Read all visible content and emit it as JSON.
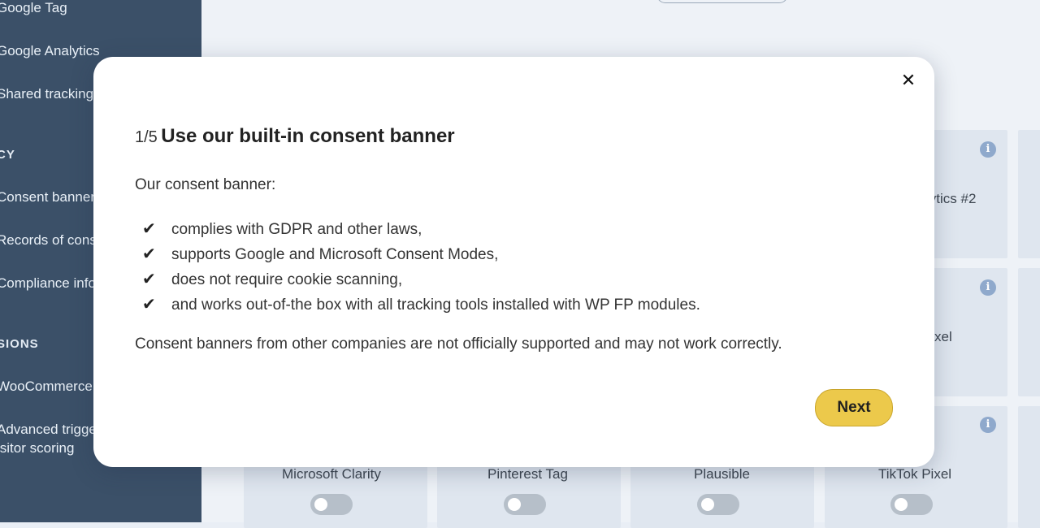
{
  "sidebar": {
    "items": [
      {
        "label": "Google Tag"
      },
      {
        "label": "Google Analytics"
      },
      {
        "label": "Shared tracking"
      },
      {
        "label": "Consent banner"
      },
      {
        "label": "Records of cons"
      },
      {
        "label": "Compliance info"
      },
      {
        "label": "WooCommerce"
      },
      {
        "label": "Advanced trigge"
      },
      {
        "label": "isitor scoring"
      }
    ],
    "headings": [
      {
        "label": "CY"
      },
      {
        "label": "SIONS"
      }
    ]
  },
  "cards": {
    "partial_labels": [
      "lytics #2",
      "xel"
    ],
    "bottom": [
      {
        "label": "Microsoft Clarity"
      },
      {
        "label": "Pinterest Tag"
      },
      {
        "label": "Plausible"
      },
      {
        "label": "TikTok Pixel"
      }
    ],
    "info_glyph": "i"
  },
  "modal": {
    "close_glyph": "✕",
    "step": "1/5",
    "title": "Use our built-in consent banner",
    "intro": "Our consent banner:",
    "check_glyph": "✔",
    "bullets": [
      "complies with GDPR and other laws,",
      "supports Google and Microsoft Consent Modes,",
      "does not require cookie scanning,",
      "and works out-of-the box with all tracking tools installed with WP FP modules."
    ],
    "note": "Consent banners from other companies are not officially supported and may not work correctly.",
    "next_label": "Next"
  },
  "colors": {
    "sidebar_bg": "#3b5068",
    "accent_button": "#ecc94b",
    "info_icon": "#8fa9cc"
  }
}
